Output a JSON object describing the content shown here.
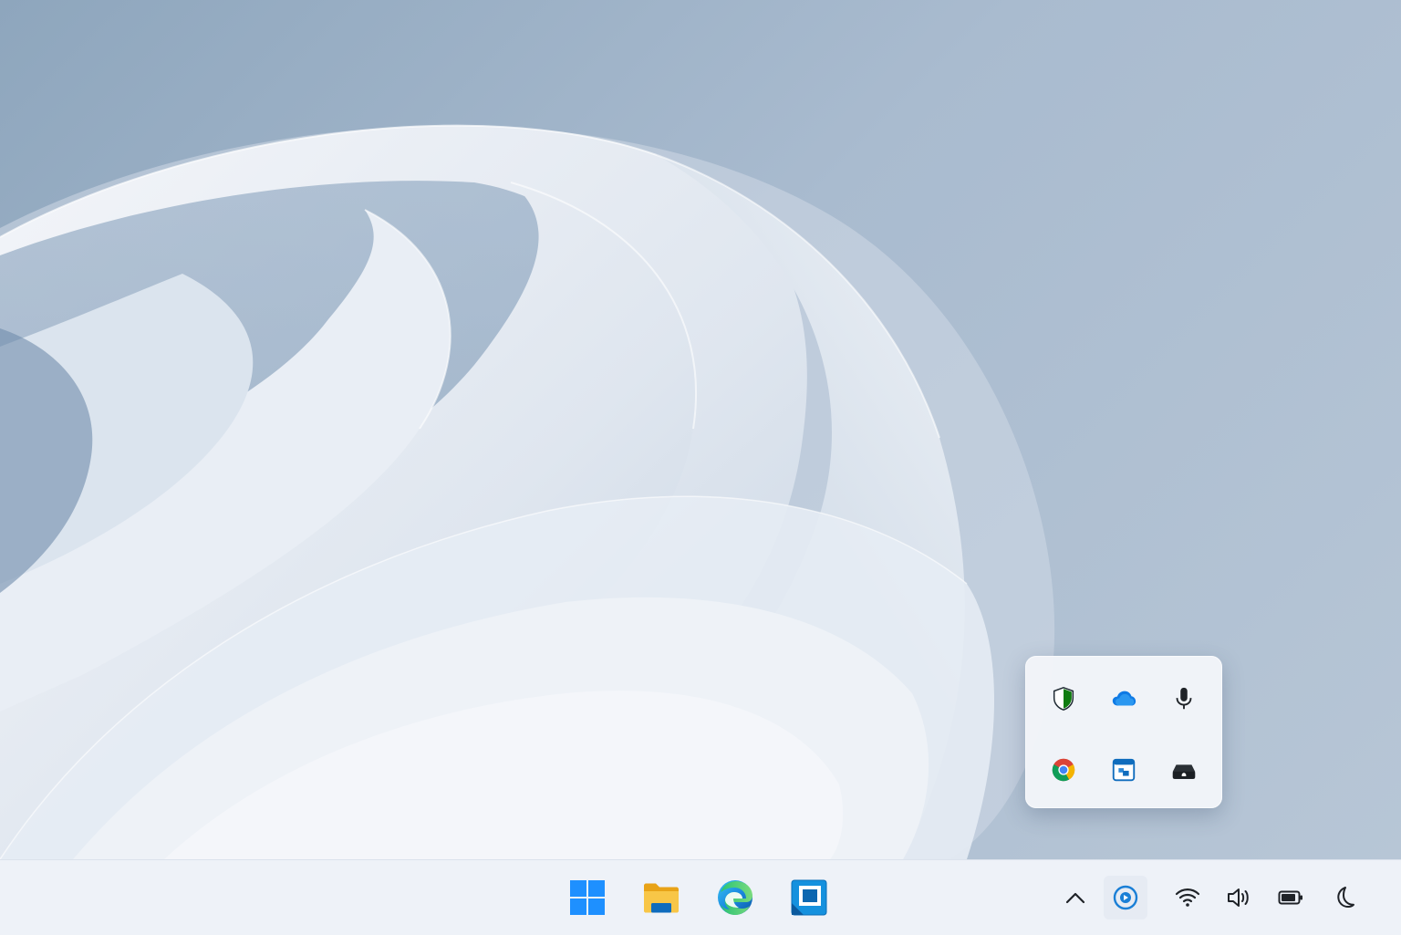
{
  "window": {
    "type": "desktop"
  },
  "colors": {
    "accent": "#0078d4",
    "defender_green": "#107c10",
    "folder_yellow": "#f8c647",
    "taskbar_bg": "#eef2f8"
  },
  "flyout": {
    "items": [
      {
        "icon": "windows-security-shield-icon"
      },
      {
        "icon": "onedrive-cloud-icon"
      },
      {
        "icon": "microphone-icon"
      },
      {
        "icon": "chrome-icon"
      },
      {
        "icon": "app-window-icon"
      },
      {
        "icon": "drive-icon"
      }
    ]
  },
  "taskbar": {
    "pinned": [
      {
        "icon": "windows-start-icon"
      },
      {
        "icon": "file-explorer-icon"
      },
      {
        "icon": "edge-icon"
      },
      {
        "icon": "remote-desktop-icon"
      }
    ],
    "tray": [
      {
        "icon": "show-hidden-icons-chevron-icon"
      },
      {
        "icon": "tray-app-icon"
      },
      {
        "icon": "wifi-icon"
      },
      {
        "icon": "volume-icon"
      },
      {
        "icon": "battery-icon"
      },
      {
        "icon": "night-light-moon-icon"
      }
    ]
  }
}
